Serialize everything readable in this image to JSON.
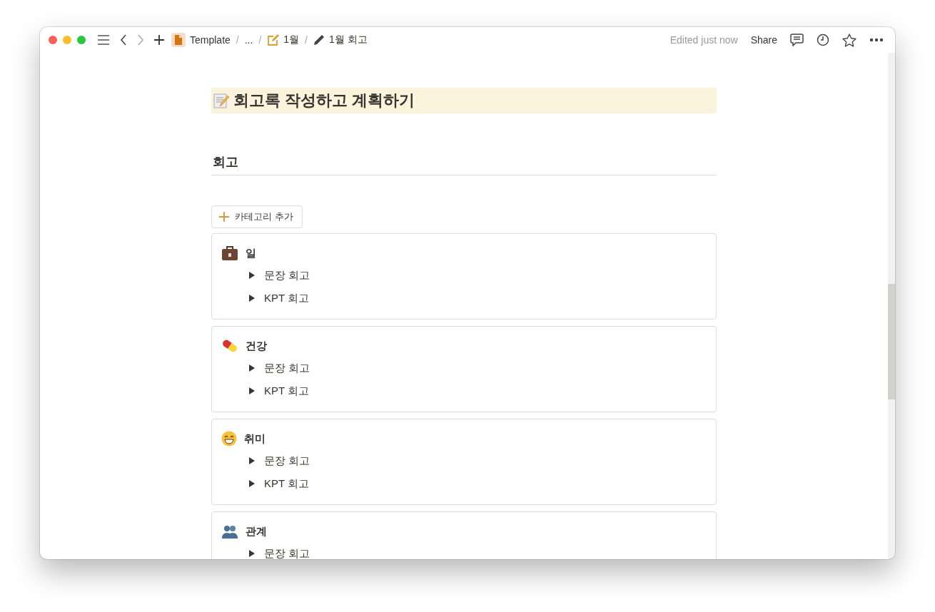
{
  "breadcrumbs": [
    {
      "label": "Template",
      "separator_after": "/"
    },
    {
      "label": "...",
      "separator_after": "/"
    },
    {
      "label": "1월",
      "separator_after": "/"
    },
    {
      "label": "1월 회고"
    }
  ],
  "status": "Edited just now",
  "share": "Share",
  "page": {
    "title": "회고록 작성하고 계획하기",
    "section": "회고",
    "add_button": "카테고리 추가",
    "categories": [
      {
        "name": "일",
        "toggles": [
          {
            "label": "문장 회고",
            "expanded": false
          },
          {
            "label": "KPT 회고",
            "expanded": false
          }
        ]
      },
      {
        "name": "건강",
        "toggles": [
          {
            "label": "문장 회고",
            "expanded": false
          },
          {
            "label": "KPT 회고",
            "expanded": false
          }
        ]
      },
      {
        "name": "취미",
        "toggles": [
          {
            "label": "문장 회고",
            "expanded": false
          },
          {
            "label": "KPT 회고",
            "expanded": false
          }
        ]
      },
      {
        "name": "관계",
        "toggles": [
          {
            "label": "문장 회고",
            "expanded": false
          }
        ]
      }
    ]
  }
}
